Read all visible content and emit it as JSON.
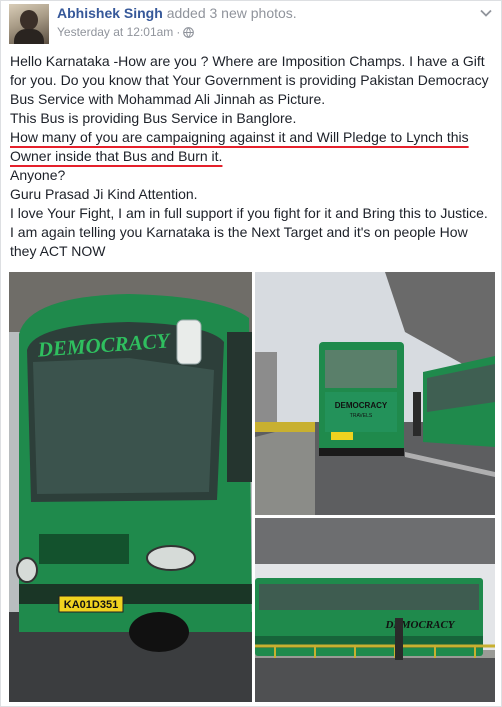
{
  "post": {
    "author_name": "Abhishek Singh",
    "action": "added 3 new photos.",
    "timestamp": "Yesterday at 12:01am",
    "audience_icon": "globe-icon",
    "menu_icon": "chevron-down-icon"
  },
  "body": {
    "line1": "Hello Karnataka -How are you ? Where are Imposition Champs. I have a Gift for you. Do you know that Your Government is providing Pakistan Democracy Bus Service with Mohammad Ali Jinnah as Picture.",
    "line2": "This Bus is providing Bus Service in Banglore.",
    "line3": "How many of you are campaigning against it and Will Pledge to Lynch this Owner inside that Bus and Burn it.",
    "line4": "Anyone?",
    "line5": "Guru Prasad Ji Kind Attention.",
    "line6": "I love Your Fight, I am in full support if you fight for it and Bring this to Justice. I am again telling you Karnataka is the Next Target and it's on people How they ACT NOW"
  },
  "photos": {
    "photo1_bus_sign": "DEMOCRACY",
    "photo1_plate": "KA01D351",
    "photo2_bus_sign": "DEMOCRACY",
    "photo2_bus_subtitle": "TRAVELS",
    "photo3_bus_sign": "DEMOCRACY"
  },
  "colors": {
    "link": "#365899",
    "meta": "#90949c",
    "underline": "#e5202b",
    "bus_green": "#1f8a4c"
  }
}
